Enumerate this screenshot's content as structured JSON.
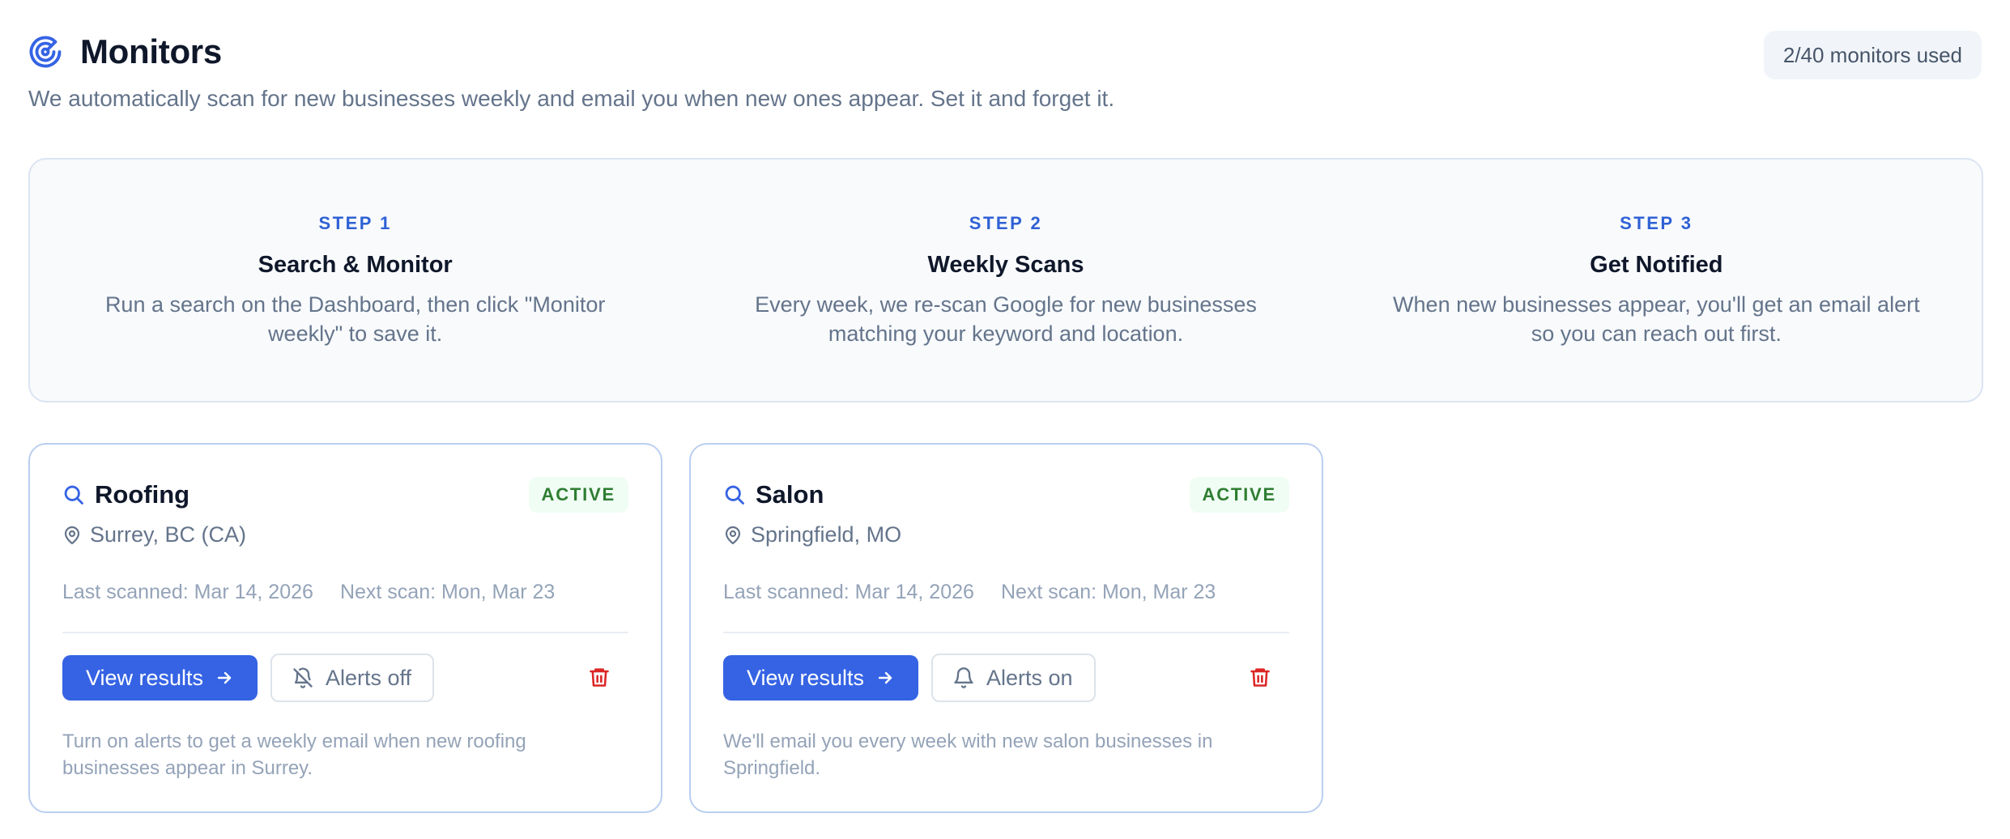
{
  "header": {
    "title": "Monitors",
    "subtitle": "We automatically scan for new businesses weekly and email you when new ones appear. Set it and forget it.",
    "usage": "2/40 monitors used",
    "icon": "radar-icon"
  },
  "steps": [
    {
      "label": "STEP 1",
      "heading": "Search & Monitor",
      "description": "Run a search on the Dashboard, then click \"Monitor weekly\" to save it."
    },
    {
      "label": "STEP 2",
      "heading": "Weekly Scans",
      "description": "Every week, we re-scan Google for new businesses matching your keyword and location."
    },
    {
      "label": "STEP 3",
      "heading": "Get Notified",
      "description": "When new businesses appear, you'll get an email alert so you can reach out first."
    }
  ],
  "monitors": [
    {
      "name": "Roofing",
      "status": "ACTIVE",
      "location": "Surrey, BC (CA)",
      "last_scanned": "Last scanned: Mar 14, 2026",
      "next_scan": "Next scan: Mon, Mar 23",
      "view_label": "View results",
      "alert_label": "Alerts off",
      "alert_icon": "bell-off-icon",
      "note": "Turn on alerts to get a weekly email when new roofing businesses appear in Surrey."
    },
    {
      "name": "Salon",
      "status": "ACTIVE",
      "location": "Springfield, MO",
      "last_scanned": "Last scanned: Mar 14, 2026",
      "next_scan": "Next scan: Mon, Mar 23",
      "view_label": "View results",
      "alert_label": "Alerts on",
      "alert_icon": "bell-icon",
      "note": "We'll email you every week with new salon businesses in Springfield."
    }
  ],
  "colors": {
    "accent": "#3563e4",
    "step_label": "#2f61d5",
    "active_badge_text": "#2e7d32",
    "active_badge_bg": "#f0fdf4",
    "delete": "#dc2626",
    "card_border": "#b9cff0"
  }
}
